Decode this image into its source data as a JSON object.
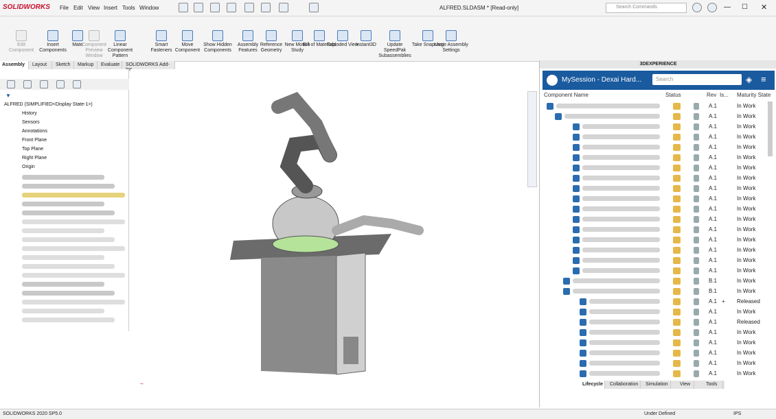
{
  "app": {
    "logo": "SOLIDWORKS",
    "title": "ALFRED.SLDASM * [Read-only]"
  },
  "menu": [
    "File",
    "Edit",
    "View",
    "Insert",
    "Tools",
    "Window"
  ],
  "search": {
    "placeholder": "Search Commands"
  },
  "commands": [
    {
      "label": "Edit Component",
      "disabled": true
    },
    {
      "label": "Insert Components",
      "disabled": false
    },
    {
      "label": "Mate",
      "disabled": false
    },
    {
      "label": "Component Preview Window",
      "disabled": true
    },
    {
      "label": "Linear Component Pattern",
      "disabled": false
    },
    {
      "label": "Smart Fasteners",
      "disabled": false
    },
    {
      "label": "Move Component",
      "disabled": false
    },
    {
      "label": "Show Hidden Components",
      "disabled": false
    },
    {
      "label": "Assembly Features",
      "disabled": false
    },
    {
      "label": "Reference Geometry",
      "disabled": false
    },
    {
      "label": "New Motion Study",
      "disabled": false
    },
    {
      "label": "Bill of Materials",
      "disabled": false
    },
    {
      "label": "Exploded View",
      "disabled": false
    },
    {
      "label": "Instant3D",
      "disabled": false
    },
    {
      "label": "Update SpeedPak Subassemblies",
      "disabled": false
    },
    {
      "label": "Take Snapshot",
      "disabled": false
    },
    {
      "label": "Large Assembly Settings",
      "disabled": false
    }
  ],
  "tabs": [
    "Assembly",
    "Layout",
    "Sketch",
    "Markup",
    "Evaluate",
    "SOLIDWORKS Add-Ins"
  ],
  "tree": {
    "root": "ALFRED  (SIMPLIFIED<Display State-1>)",
    "items": [
      "History",
      "Sensors",
      "Annotations",
      "Front Plane",
      "Top Plane",
      "Right Plane",
      "Origin"
    ]
  },
  "rightpanel": {
    "header": "3DEXPERIENCE",
    "session": "MySession - Dexai Hard...",
    "search_placeholder": "Search",
    "columns": [
      "Component Name",
      "Status",
      "Rev",
      "Is...",
      "Maturity State"
    ],
    "rows": [
      {
        "rev": "A.1",
        "mat": "In Work",
        "plus": ""
      },
      {
        "rev": "A.1",
        "mat": "In Work",
        "plus": ""
      },
      {
        "rev": "A.1",
        "mat": "In Work",
        "plus": ""
      },
      {
        "rev": "A.1",
        "mat": "In Work",
        "plus": ""
      },
      {
        "rev": "A.1",
        "mat": "In Work",
        "plus": ""
      },
      {
        "rev": "A.1",
        "mat": "In Work",
        "plus": ""
      },
      {
        "rev": "A.1",
        "mat": "In Work",
        "plus": ""
      },
      {
        "rev": "A.1",
        "mat": "In Work",
        "plus": ""
      },
      {
        "rev": "A.1",
        "mat": "In Work",
        "plus": ""
      },
      {
        "rev": "A.1",
        "mat": "In Work",
        "plus": ""
      },
      {
        "rev": "A.1",
        "mat": "In Work",
        "plus": ""
      },
      {
        "rev": "A.1",
        "mat": "In Work",
        "plus": ""
      },
      {
        "rev": "A.1",
        "mat": "In Work",
        "plus": ""
      },
      {
        "rev": "A.1",
        "mat": "In Work",
        "plus": ""
      },
      {
        "rev": "A.1",
        "mat": "In Work",
        "plus": ""
      },
      {
        "rev": "A.1",
        "mat": "In Work",
        "plus": ""
      },
      {
        "rev": "A.1",
        "mat": "In Work",
        "plus": ""
      },
      {
        "rev": "B.1",
        "mat": "In Work",
        "plus": ""
      },
      {
        "rev": "B.1",
        "mat": "In Work",
        "plus": ""
      },
      {
        "rev": "A.1",
        "mat": "Released",
        "plus": "+"
      },
      {
        "rev": "A.1",
        "mat": "In Work",
        "plus": ""
      },
      {
        "rev": "A.1",
        "mat": "Released",
        "plus": ""
      },
      {
        "rev": "A.1",
        "mat": "In Work",
        "plus": ""
      },
      {
        "rev": "A.1",
        "mat": "In Work",
        "plus": ""
      },
      {
        "rev": "A.1",
        "mat": "In Work",
        "plus": ""
      },
      {
        "rev": "A.1",
        "mat": "In Work",
        "plus": ""
      },
      {
        "rev": "A.1",
        "mat": "In Work",
        "plus": ""
      }
    ],
    "bottomtabs": [
      "Lifecycle",
      "Collaboration",
      "Simulation",
      "View",
      "Tools"
    ]
  },
  "status": {
    "version": "SOLIDWORKS 2020 SP5.0",
    "state": "Under Defined",
    "units": "IPS"
  }
}
